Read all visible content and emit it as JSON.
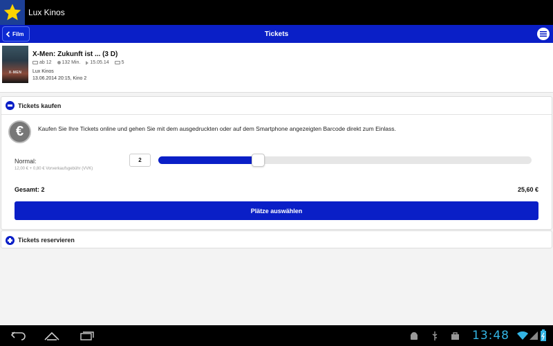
{
  "app": {
    "title": "Lux Kinos",
    "icon": "star-icon"
  },
  "navbar": {
    "back_label": "Film",
    "title": "Tickets"
  },
  "movie": {
    "poster_text": "X-MEN",
    "title": "X-Men: Zukunft ist ... (3 D)",
    "age": "ab 12",
    "duration": "132 Min.",
    "release": "15.05.14",
    "count": "5",
    "cinema": "Lux Kinos",
    "showtime": "13.06.2014 20:15, Kino 2"
  },
  "buy": {
    "header": "Tickets kaufen",
    "info": "Kaufen Sie Ihre Tickets online und gehen Sie mit dem ausgedruckten oder auf dem Smartphone angezeigten Barcode direkt zum Einlass.",
    "euro_symbol": "€",
    "ticket_type": "Normal:",
    "ticket_fee": "12,00 € + 0,80 € Vorverkaufsgebühr (VVK)",
    "quantity": "2",
    "slider_fraction": 0.25,
    "total_label": "Gesamt: 2",
    "total_amount": "25,60 €",
    "button_label": "Plätze auswählen"
  },
  "reserve": {
    "header": "Tickets reservieren"
  },
  "system": {
    "clock": "13:48"
  },
  "colors": {
    "brand_blue": "#0a1fc7",
    "clock": "#33b5e5"
  }
}
